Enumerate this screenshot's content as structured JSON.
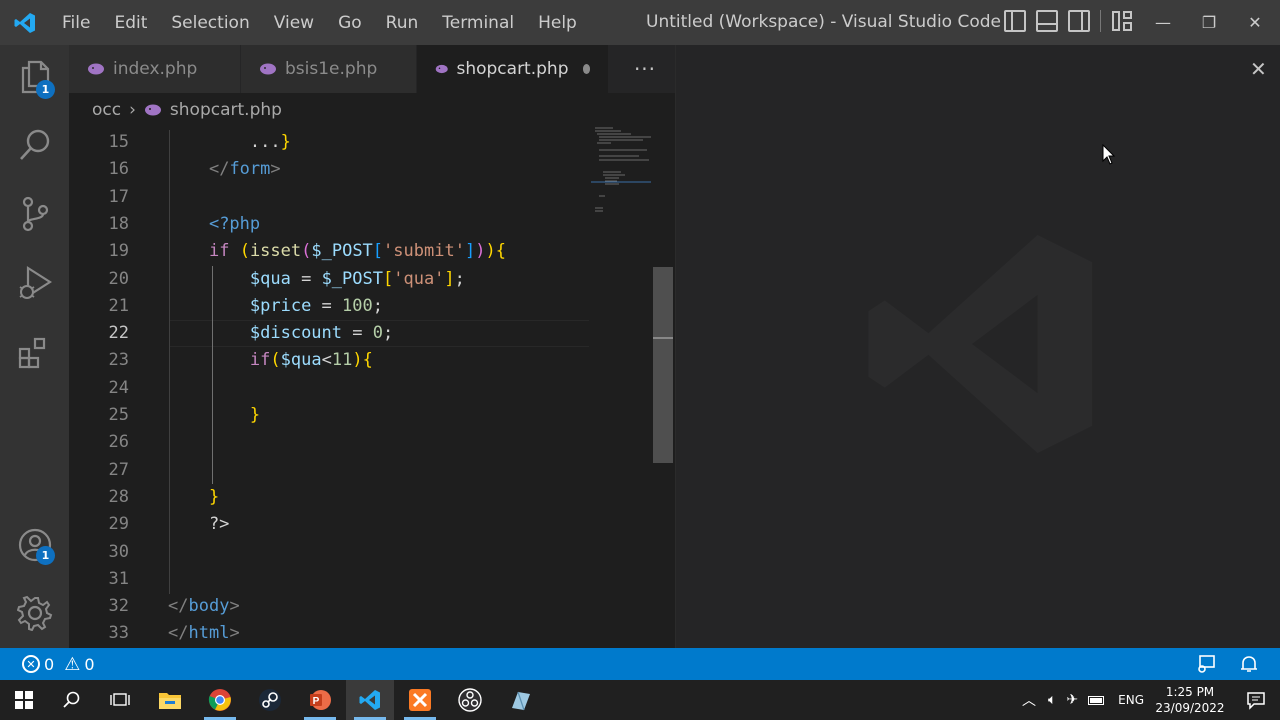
{
  "menu": [
    "File",
    "Edit",
    "Selection",
    "View",
    "Go",
    "Run",
    "Terminal",
    "Help"
  ],
  "window_title": "Untitled (Workspace) - Visual Studio Code",
  "tabs": [
    {
      "label": "index.php",
      "active": false
    },
    {
      "label": "bsis1e.php",
      "active": false
    },
    {
      "label": "shopcart.php",
      "active": true,
      "modified": true
    }
  ],
  "tab_more": "···",
  "breadcrumb": {
    "folder": "occ",
    "file": "shopcart.php"
  },
  "activity": {
    "explorer_badge": "1",
    "accounts_badge": "1"
  },
  "code_lines": [
    {
      "num": "15",
      "text": "        ...}"
    },
    {
      "num": "16",
      "text": "    </form>"
    },
    {
      "num": "17",
      "text": ""
    },
    {
      "num": "18",
      "text": "    <?php"
    },
    {
      "num": "19",
      "text": "    if (isset($_POST['submit'])){"
    },
    {
      "num": "20",
      "text": "        $qua = $_POST['qua'];"
    },
    {
      "num": "21",
      "text": "        $price = 100;"
    },
    {
      "num": "22",
      "text": "        $discount = 0;"
    },
    {
      "num": "23",
      "text": "        if($qua<11){"
    },
    {
      "num": "24",
      "text": ""
    },
    {
      "num": "25",
      "text": "        }"
    },
    {
      "num": "26",
      "text": ""
    },
    {
      "num": "27",
      "text": ""
    },
    {
      "num": "28",
      "text": "    }"
    },
    {
      "num": "29",
      "text": "    ?>"
    },
    {
      "num": "30",
      "text": ""
    },
    {
      "num": "31",
      "text": ""
    },
    {
      "num": "32",
      "text": "</body>"
    },
    {
      "num": "33",
      "text": "</html>"
    }
  ],
  "status": {
    "errors": "0",
    "warnings": "0"
  },
  "taskbar": {
    "lang": "ENG",
    "time": "1:25 PM",
    "date": "23/09/2022"
  },
  "colors": {
    "accent": "#007acc",
    "tag": "#808080",
    "tagname": "#569cd6",
    "keyword": "#c586c0",
    "var": "#9cdcfe",
    "string": "#ce9178",
    "number": "#b5cea8",
    "func": "#dcdcaa",
    "bracket": "#ffd700"
  }
}
